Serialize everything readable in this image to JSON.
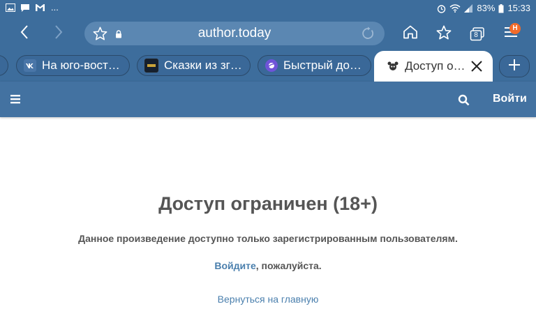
{
  "status_bar": {
    "overflow": "...",
    "battery": "83%",
    "time": "15:33",
    "icons": [
      "image-icon",
      "chat-icon",
      "gmail-icon",
      "alarm-icon",
      "wifi-icon",
      "signal-icon",
      "battery-icon"
    ]
  },
  "browser": {
    "url": "author.today",
    "tabs_count": "8",
    "menu_badge": "H",
    "tabs": [
      {
        "title": "На юго-вост…",
        "favicon": "vk-icon"
      },
      {
        "title": "Сказки из зг…",
        "favicon": "site-icon"
      },
      {
        "title": "Быстрый до…",
        "favicon": "samsung-internet-icon"
      },
      {
        "title": "Доступ о…",
        "favicon": "author-today-icon",
        "active": true
      }
    ]
  },
  "site_header": {
    "login_label": "Войти"
  },
  "page": {
    "title": "Доступ ограничен (18+)",
    "description": "Данное произведение доступно только зарегистрированным пользователям.",
    "login_link": "Войдите",
    "login_suffix": ", пожалуйста.",
    "home_link": "Вернуться на главную"
  },
  "colors": {
    "chrome": "#3d6d9c",
    "site_header": "#4372a1",
    "link": "#4a7fad",
    "text": "#555555",
    "badge": "#f26b2a"
  }
}
